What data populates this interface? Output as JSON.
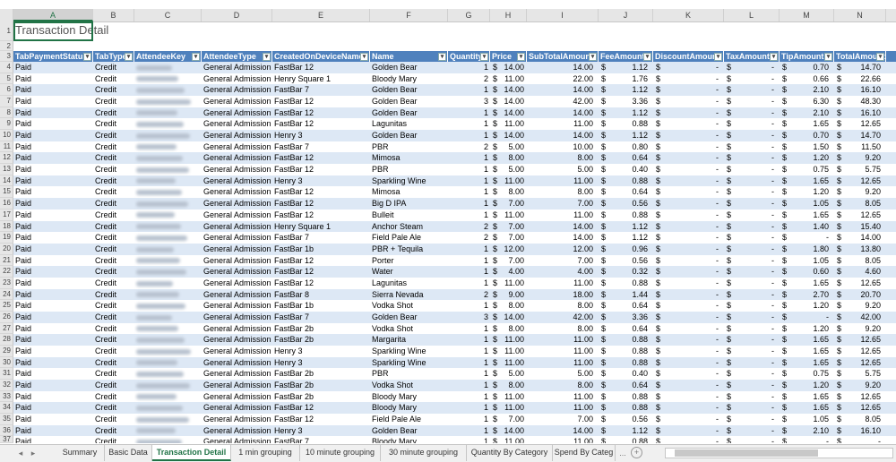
{
  "sheet_title": "Transaction Detail",
  "column_letters": [
    "A",
    "B",
    "C",
    "D",
    "E",
    "F",
    "G",
    "H",
    "I",
    "J",
    "K",
    "L",
    "M",
    "N"
  ],
  "headers": [
    "TabPaymentStatus",
    "TabType",
    "AttendeeKey",
    "AttendeeType",
    "CreatedOnDeviceName",
    "Name",
    "Quantity",
    "Price",
    "SubTotalAmount",
    "FeeAmount",
    "DiscountAmount",
    "TaxAmount",
    "TipAmount",
    "TotalAmount"
  ],
  "row_numbers": [
    "1",
    "2",
    "3",
    "4",
    "5",
    "6",
    "7",
    "8",
    "9",
    "10",
    "11",
    "12",
    "13",
    "14",
    "15",
    "16",
    "17",
    "18",
    "19",
    "20",
    "21",
    "22",
    "23",
    "24",
    "25",
    "26",
    "27",
    "28",
    "29",
    "30",
    "31",
    "32",
    "33",
    "34",
    "35",
    "36",
    "37"
  ],
  "rows": [
    [
      "Paid",
      "Credit",
      "",
      "General Admission",
      "FastBar 12",
      "Golden Bear",
      "1",
      "$ 14.00",
      "14.00",
      "$ 1.12",
      "$ -",
      "$ -",
      "$ 0.70",
      "$ 14.70"
    ],
    [
      "Paid",
      "Credit",
      "",
      "General Admission",
      "Henry Square 1",
      "Bloody Mary",
      "2",
      "$ 11.00",
      "22.00",
      "$ 1.76",
      "$ -",
      "$ -",
      "$ 0.66",
      "$ 22.66"
    ],
    [
      "Paid",
      "Credit",
      "",
      "General Admission",
      "FastBar 7",
      "Golden Bear",
      "1",
      "$ 14.00",
      "14.00",
      "$ 1.12",
      "$ -",
      "$ -",
      "$ 2.10",
      "$ 16.10"
    ],
    [
      "Paid",
      "Credit",
      "",
      "General Admission",
      "FastBar 12",
      "Golden Bear",
      "3",
      "$ 14.00",
      "42.00",
      "$ 3.36",
      "$ -",
      "$ -",
      "$ 6.30",
      "$ 48.30"
    ],
    [
      "Paid",
      "Credit",
      "",
      "General Admission",
      "FastBar 12",
      "Golden Bear",
      "1",
      "$ 14.00",
      "14.00",
      "$ 1.12",
      "$ -",
      "$ -",
      "$ 2.10",
      "$ 16.10"
    ],
    [
      "Paid",
      "Credit",
      "",
      "General Admission",
      "FastBar 12",
      "Lagunitas",
      "1",
      "$ 11.00",
      "11.00",
      "$ 0.88",
      "$ -",
      "$ -",
      "$ 1.65",
      "$ 12.65"
    ],
    [
      "Paid",
      "Credit",
      "",
      "General Admission",
      "Henry 3",
      "Golden Bear",
      "1",
      "$ 14.00",
      "14.00",
      "$ 1.12",
      "$ -",
      "$ -",
      "$ 0.70",
      "$ 14.70"
    ],
    [
      "Paid",
      "Credit",
      "",
      "General Admission",
      "FastBar 7",
      "PBR",
      "2",
      "$ 5.00",
      "10.00",
      "$ 0.80",
      "$ -",
      "$ -",
      "$ 1.50",
      "$ 11.50"
    ],
    [
      "Paid",
      "Credit",
      "",
      "General Admission",
      "FastBar 12",
      "Mimosa",
      "1",
      "$ 8.00",
      "8.00",
      "$ 0.64",
      "$ -",
      "$ -",
      "$ 1.20",
      "$ 9.20"
    ],
    [
      "Paid",
      "Credit",
      "",
      "General Admission",
      "FastBar 12",
      "PBR",
      "1",
      "$ 5.00",
      "5.00",
      "$ 0.40",
      "$ -",
      "$ -",
      "$ 0.75",
      "$ 5.75"
    ],
    [
      "Paid",
      "Credit",
      "",
      "General Admission",
      "Henry 3",
      "Sparkling Wine",
      "1",
      "$ 11.00",
      "11.00",
      "$ 0.88",
      "$ -",
      "$ -",
      "$ 1.65",
      "$ 12.65"
    ],
    [
      "Paid",
      "Credit",
      "",
      "General Admission",
      "FastBar 12",
      "Mimosa",
      "1",
      "$ 8.00",
      "8.00",
      "$ 0.64",
      "$ -",
      "$ -",
      "$ 1.20",
      "$ 9.20"
    ],
    [
      "Paid",
      "Credit",
      "",
      "General Admission",
      "FastBar 12",
      "Big D IPA",
      "1",
      "$ 7.00",
      "7.00",
      "$ 0.56",
      "$ -",
      "$ -",
      "$ 1.05",
      "$ 8.05"
    ],
    [
      "Paid",
      "Credit",
      "",
      "General Admission",
      "FastBar 12",
      "Bulleit",
      "1",
      "$ 11.00",
      "11.00",
      "$ 0.88",
      "$ -",
      "$ -",
      "$ 1.65",
      "$ 12.65"
    ],
    [
      "Paid",
      "Credit",
      "",
      "General Admission",
      "Henry Square 1",
      "Anchor Steam",
      "2",
      "$ 7.00",
      "14.00",
      "$ 1.12",
      "$ -",
      "$ -",
      "$ 1.40",
      "$ 15.40"
    ],
    [
      "Paid",
      "Credit",
      "",
      "General Admission",
      "FastBar 7",
      "Field Pale Ale",
      "2",
      "$ 7.00",
      "14.00",
      "$ 1.12",
      "$ -",
      "$ -",
      "$ -",
      "$ 14.00"
    ],
    [
      "Paid",
      "Credit",
      "",
      "General Admission",
      "FastBar 1b",
      "PBR + Tequila",
      "1",
      "$ 12.00",
      "12.00",
      "$ 0.96",
      "$ -",
      "$ -",
      "$ 1.80",
      "$ 13.80"
    ],
    [
      "Paid",
      "Credit",
      "",
      "General Admission",
      "FastBar 12",
      "Porter",
      "1",
      "$ 7.00",
      "7.00",
      "$ 0.56",
      "$ -",
      "$ -",
      "$ 1.05",
      "$ 8.05"
    ],
    [
      "Paid",
      "Credit",
      "",
      "General Admission",
      "FastBar 12",
      "Water",
      "1",
      "$ 4.00",
      "4.00",
      "$ 0.32",
      "$ -",
      "$ -",
      "$ 0.60",
      "$ 4.60"
    ],
    [
      "Paid",
      "Credit",
      "",
      "General Admission",
      "FastBar 12",
      "Lagunitas",
      "1",
      "$ 11.00",
      "11.00",
      "$ 0.88",
      "$ -",
      "$ -",
      "$ 1.65",
      "$ 12.65"
    ],
    [
      "Paid",
      "Credit",
      "",
      "General Admission",
      "FastBar 8",
      "Sierra Nevada",
      "2",
      "$ 9.00",
      "18.00",
      "$ 1.44",
      "$ -",
      "$ -",
      "$ 2.70",
      "$ 20.70"
    ],
    [
      "Paid",
      "Credit",
      "",
      "General Admission",
      "FastBar 1b",
      "Vodka Shot",
      "1",
      "$ 8.00",
      "8.00",
      "$ 0.64",
      "$ -",
      "$ -",
      "$ 1.20",
      "$ 9.20"
    ],
    [
      "Paid",
      "Credit",
      "",
      "General Admission",
      "FastBar 7",
      "Golden Bear",
      "3",
      "$ 14.00",
      "42.00",
      "$ 3.36",
      "$ -",
      "$ -",
      "$ -",
      "$ 42.00"
    ],
    [
      "Paid",
      "Credit",
      "",
      "General Admission",
      "FastBar 2b",
      "Vodka Shot",
      "1",
      "$ 8.00",
      "8.00",
      "$ 0.64",
      "$ -",
      "$ -",
      "$ 1.20",
      "$ 9.20"
    ],
    [
      "Paid",
      "Credit",
      "",
      "General Admission",
      "FastBar 2b",
      "Margarita",
      "1",
      "$ 11.00",
      "11.00",
      "$ 0.88",
      "$ -",
      "$ -",
      "$ 1.65",
      "$ 12.65"
    ],
    [
      "Paid",
      "Credit",
      "",
      "General Admission",
      "Henry 3",
      "Sparkling Wine",
      "1",
      "$ 11.00",
      "11.00",
      "$ 0.88",
      "$ -",
      "$ -",
      "$ 1.65",
      "$ 12.65"
    ],
    [
      "Paid",
      "Credit",
      "",
      "General Admission",
      "Henry 3",
      "Sparkling Wine",
      "1",
      "$ 11.00",
      "11.00",
      "$ 0.88",
      "$ -",
      "$ -",
      "$ 1.65",
      "$ 12.65"
    ],
    [
      "Paid",
      "Credit",
      "",
      "General Admission",
      "FastBar 2b",
      "PBR",
      "1",
      "$ 5.00",
      "5.00",
      "$ 0.40",
      "$ -",
      "$ -",
      "$ 0.75",
      "$ 5.75"
    ],
    [
      "Paid",
      "Credit",
      "",
      "General Admission",
      "FastBar 2b",
      "Vodka Shot",
      "1",
      "$ 8.00",
      "8.00",
      "$ 0.64",
      "$ -",
      "$ -",
      "$ 1.20",
      "$ 9.20"
    ],
    [
      "Paid",
      "Credit",
      "",
      "General Admission",
      "FastBar 2b",
      "Bloody Mary",
      "1",
      "$ 11.00",
      "11.00",
      "$ 0.88",
      "$ -",
      "$ -",
      "$ 1.65",
      "$ 12.65"
    ],
    [
      "Paid",
      "Credit",
      "",
      "General Admission",
      "FastBar 12",
      "Bloody Mary",
      "1",
      "$ 11.00",
      "11.00",
      "$ 0.88",
      "$ -",
      "$ -",
      "$ 1.65",
      "$ 12.65"
    ],
    [
      "Paid",
      "Credit",
      "",
      "General Admission",
      "FastBar 12",
      "Field Pale Ale",
      "1",
      "$ 7.00",
      "7.00",
      "$ 0.56",
      "$ -",
      "$ -",
      "$ 1.05",
      "$ 8.05"
    ],
    [
      "Paid",
      "Credit",
      "",
      "General Admission",
      "Henry 3",
      "Golden Bear",
      "1",
      "$ 14.00",
      "14.00",
      "$ 1.12",
      "$ -",
      "$ -",
      "$ 2.10",
      "$ 16.10"
    ],
    [
      "Paid",
      "Credit",
      "",
      "General Admission",
      "FastBar 7",
      "Bloody Mary",
      "1",
      "$ 11.00",
      "11.00",
      "$ 0.88",
      "$ -",
      "$ -",
      "$ -",
      "$ -"
    ]
  ],
  "sheet_tabs": [
    "Summary",
    "Basic Data",
    "Transaction Detail",
    "1 min grouping",
    "10 minute grouping",
    "30 minute grouping",
    "Quantity By Category",
    "Spend By Categ"
  ],
  "active_tab": "Transaction Detail",
  "nav": {
    "prev": "◂",
    "next": "▸",
    "more": "...",
    "add": "+"
  },
  "colors": {
    "header_blue": "#4f81bd",
    "band": "#dde8f5",
    "excel_green": "#217346"
  }
}
